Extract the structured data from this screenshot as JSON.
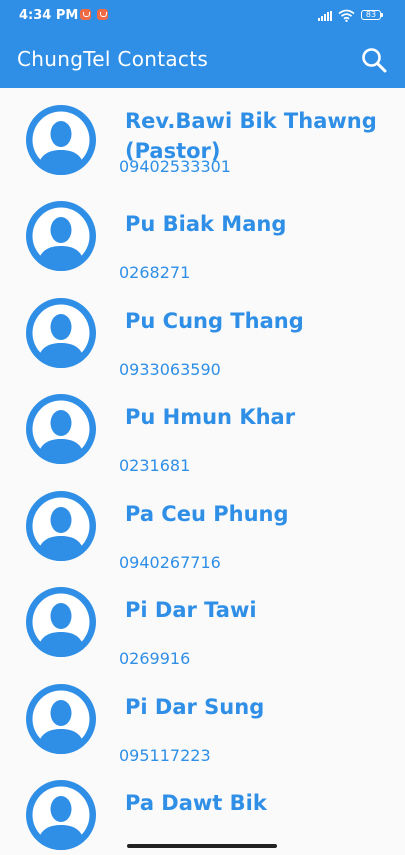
{
  "status_bar": {
    "time": "4:34 PM",
    "battery": "83"
  },
  "app_bar": {
    "title": "ChungTel Contacts"
  },
  "icons": {
    "search": "search-icon",
    "avatar": "person-avatar-icon"
  },
  "colors": {
    "primary": "#2f8fe6",
    "background": "#fafafa"
  },
  "contacts": [
    {
      "name_line1": "Rev.Bawi Bik Thawng",
      "name_line2": "(Pastor)",
      "phone": "09402533301"
    },
    {
      "name_line1": "Pu Biak Mang",
      "name_line2": "",
      "phone": "0268271"
    },
    {
      "name_line1": "Pu Cung Thang",
      "name_line2": "",
      "phone": "0933063590"
    },
    {
      "name_line1": "Pu Hmun Khar",
      "name_line2": "",
      "phone": "0231681"
    },
    {
      "name_line1": "Pa Ceu Phung",
      "name_line2": "",
      "phone": "0940267716"
    },
    {
      "name_line1": "Pi Dar Tawi",
      "name_line2": "",
      "phone": "0269916"
    },
    {
      "name_line1": "Pi Dar Sung",
      "name_line2": "",
      "phone": "095117223"
    },
    {
      "name_line1": "Pa Dawt Bik",
      "name_line2": "",
      "phone": ""
    }
  ]
}
